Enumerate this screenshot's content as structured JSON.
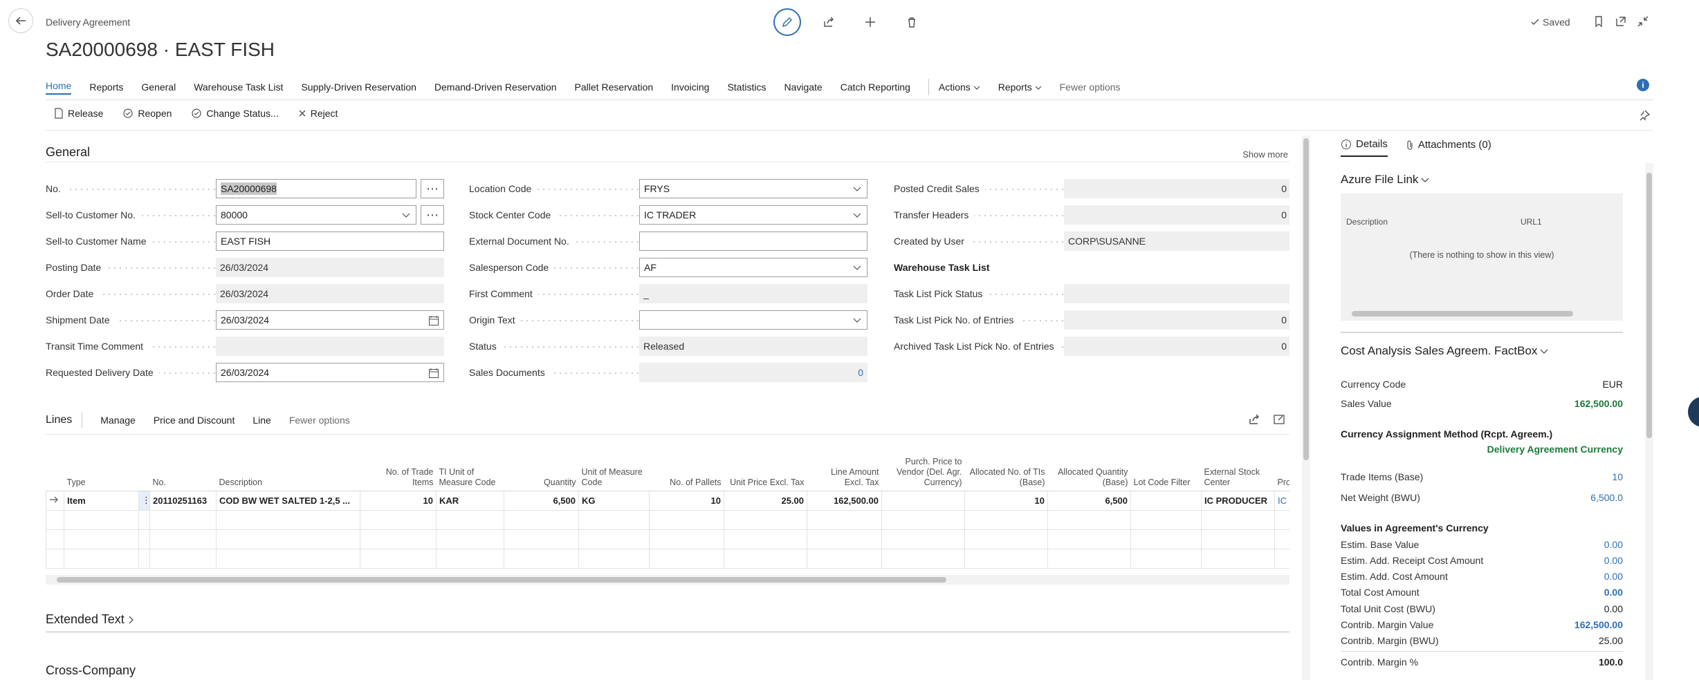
{
  "header": {
    "breadcrumb": "Delivery Agreement",
    "title": "SA20000698 · EAST FISH",
    "saved_label": "Saved"
  },
  "actionbar": {
    "items": [
      "Home",
      "Reports",
      "General",
      "Warehouse Task List",
      "Supply-Driven Reservation",
      "Demand-Driven Reservation",
      "Pallet Reservation",
      "Invoicing",
      "Statistics",
      "Navigate",
      "Catch Reporting"
    ],
    "actions_label": "Actions",
    "reports_label": "Reports",
    "fewer_label": "Fewer options"
  },
  "promoted": {
    "release": "Release",
    "reopen": "Reopen",
    "change_status": "Change Status...",
    "reject": "Reject"
  },
  "general": {
    "title": "General",
    "show_more": "Show more",
    "col1": {
      "no_label": "No.",
      "no_value": "SA20000698",
      "sell_to_no_label": "Sell-to Customer No.",
      "sell_to_no_value": "80000",
      "sell_to_name_label": "Sell-to Customer Name",
      "sell_to_name_value": "EAST FISH",
      "posting_date_label": "Posting Date",
      "posting_date_value": "26/03/2024",
      "order_date_label": "Order Date",
      "order_date_value": "26/03/2024",
      "shipment_date_label": "Shipment Date",
      "shipment_date_value": "26/03/2024",
      "transit_label": "Transit Time Comment",
      "transit_value": "",
      "req_delivery_label": "Requested Delivery Date",
      "req_delivery_value": "26/03/2024"
    },
    "col2": {
      "location_label": "Location Code",
      "location_value": "FRYS",
      "stock_center_label": "Stock Center Code",
      "stock_center_value": "IC TRADER",
      "ext_doc_label": "External Document No.",
      "ext_doc_value": "",
      "salesperson_label": "Salesperson Code",
      "salesperson_value": "AF",
      "first_comment_label": "First Comment",
      "first_comment_value": "_",
      "origin_label": "Origin Text",
      "origin_value": "",
      "status_label": "Status",
      "status_value": "Released",
      "sales_docs_label": "Sales Documents",
      "sales_docs_value": "0"
    },
    "col3": {
      "posted_credit_label": "Posted Credit Sales",
      "posted_credit_value": "0",
      "transfer_headers_label": "Transfer Headers",
      "transfer_headers_value": "0",
      "created_by_label": "Created by User",
      "created_by_value": "CORP\\SUSANNE",
      "wtl_heading": "Warehouse Task List",
      "pick_status_label": "Task List Pick Status",
      "pick_status_value": "",
      "pick_entries_label": "Task List Pick No. of Entries",
      "pick_entries_value": "0",
      "archived_label": "Archived Task List Pick No. of Entries",
      "archived_value": "0"
    }
  },
  "lines": {
    "title": "Lines",
    "manage": "Manage",
    "price_discount": "Price and Discount",
    "line": "Line",
    "fewer": "Fewer options",
    "columns": {
      "type": "Type",
      "no": "No.",
      "description": "Description",
      "trade_items": "No. of Trade Items",
      "tl_uom": "TI Unit of Measure Code",
      "quantity": "Quantity",
      "uom": "Unit of Measure Code",
      "pallets": "No. of Pallets",
      "unit_price": "Unit Price Excl. Tax",
      "line_amount": "Line Amount Excl. Tax",
      "purch_price": "Purch. Price to Vendor (Del. Agr. Currency)",
      "alloc_tls": "Allocated No. of TIs (Base)",
      "alloc_qty": "Allocated Quantity (Base)",
      "lot_filter": "Lot Code Filter",
      "ext_stock": "External Stock Center",
      "pro": "Pro"
    },
    "row": {
      "type": "Item",
      "no": "20110251163",
      "description": "COD BW WET SALTED 1-2,5 ...",
      "trade_items": "10",
      "tl_uom": "KAR",
      "quantity": "6,500",
      "uom": "KG",
      "pallets": "10",
      "unit_price": "25.00",
      "line_amount": "162,500.00",
      "purch_price": "",
      "alloc_tls": "10",
      "alloc_qty": "6,500",
      "lot_filter": "",
      "ext_stock": "IC PRODUCER",
      "pro": "IC"
    }
  },
  "extended_text": "Extended Text",
  "cross_company": "Cross-Company",
  "factbox": {
    "tab_details": "Details",
    "tab_attachments": "Attachments (0)",
    "azure_title": "Azure File Link",
    "azure_col1": "Description",
    "azure_col2": "URL1",
    "azure_empty": "(There is nothing to show in this view)",
    "cost_title": "Cost Analysis Sales Agreem. FactBox",
    "currency_code_label": "Currency Code",
    "currency_code_value": "EUR",
    "sales_value_label": "Sales Value",
    "sales_value_value": "162,500.00",
    "assign_method_label": "Currency Assignment Method (Rcpt. Agreem.)",
    "assign_method_value": "Delivery Agreement Currency",
    "trade_items_label": "Trade Items (Base)",
    "trade_items_value": "10",
    "net_weight_label": "Net Weight (BWU)",
    "net_weight_value": "6,500.0",
    "values_heading": "Values in Agreement's Currency",
    "estim_base_label": "Estim. Base Value",
    "estim_base_value": "0.00",
    "estim_receipt_label": "Estim. Add. Receipt Cost Amount",
    "estim_receipt_value": "0.00",
    "estim_cost_label": "Estim. Add. Cost Amount",
    "estim_cost_value": "0.00",
    "total_cost_label": "Total Cost Amount",
    "total_cost_value": "0.00",
    "total_unit_label": "Total Unit Cost (BWU)",
    "total_unit_value": "0.00",
    "margin_value_label": "Contrib. Margin Value",
    "margin_value_value": "162,500.00",
    "margin_bwu_label": "Contrib. Margin (BWU)",
    "margin_bwu_value": "25.00",
    "margin_pct_label": "Contrib. Margin %",
    "margin_pct_value": "100.0"
  },
  "icons": [
    "back-arrow-icon",
    "edit-pencil-icon",
    "share-icon",
    "add-icon",
    "delete-icon",
    "check-icon",
    "bookmark-icon",
    "open-new-window-icon",
    "collapse-icon",
    "info-icon",
    "pin-icon",
    "document-icon",
    "reopen-icon",
    "change-status-icon",
    "reject-x-icon",
    "ellipsis-icon",
    "chevron-down-icon",
    "calendar-icon",
    "row-arrow-icon",
    "more-vertical-icon",
    "attachment-icon"
  ]
}
